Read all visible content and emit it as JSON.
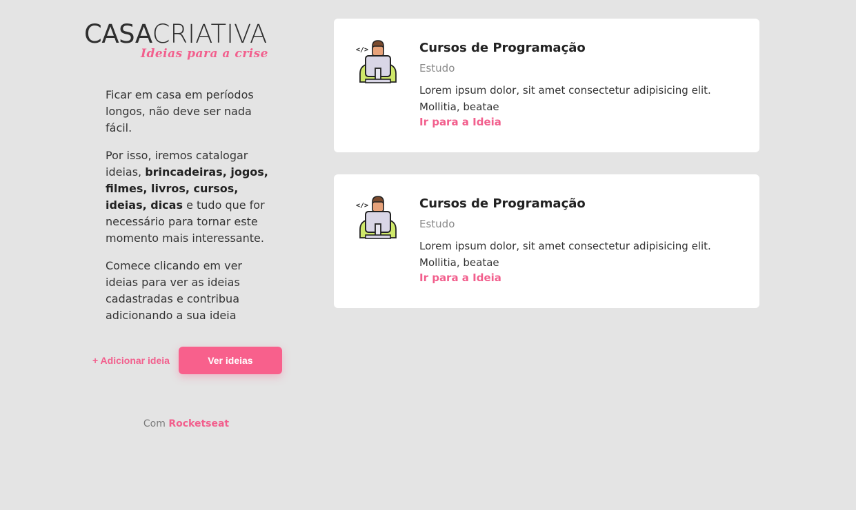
{
  "logo": {
    "part1": "CASA",
    "part2": "CRIATIVA",
    "tagline": "Ideias para a crise"
  },
  "intro": {
    "p1": "Ficar em casa em períodos longos, não deve ser nada fácil.",
    "p2_start": "Por isso, iremos catalogar ideias, ",
    "p2_bold": "brincadeiras, jogos, filmes, livros, cursos, ideias, dicas",
    "p2_end": " e tudo que for necessário para tornar este momento mais interessante.",
    "p3": "Comece clicando em ver ideias para ver as ideias cadastradas e contribua adicionando a sua ideia"
  },
  "actions": {
    "add_label": "+ Adicionar ideia",
    "see_label": "Ver ideias"
  },
  "footer": {
    "prefix": "Com ",
    "brand": "Rocketseat"
  },
  "ideas": [
    {
      "title": "Cursos de Programação",
      "category": "Estudo",
      "description": "Lorem ipsum dolor, sit amet consectetur adipisicing elit. Mollitia, beatae",
      "link_label": "Ir para a Ideia",
      "icon": "programmer-icon"
    },
    {
      "title": "Cursos de Programação",
      "category": "Estudo",
      "description": "Lorem ipsum dolor, sit amet consectetur adipisicing elit. Mollitia, beatae",
      "link_label": "Ir para a Ideia",
      "icon": "programmer-icon"
    }
  ],
  "colors": {
    "background": "#e4e4e4",
    "accent": "#f25f8d",
    "button": "#f8608c",
    "card": "#ffffff"
  }
}
